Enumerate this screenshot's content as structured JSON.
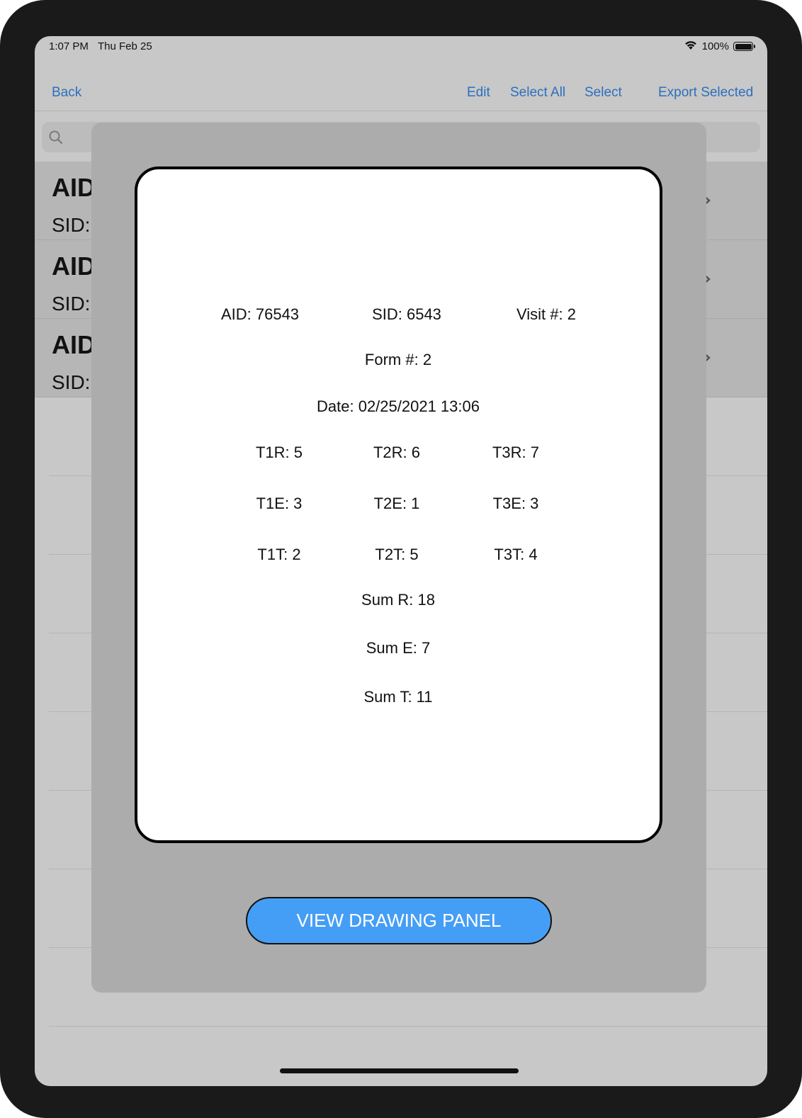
{
  "status_bar": {
    "time": "1:07 PM",
    "date": "Thu Feb 25",
    "battery": "100%"
  },
  "nav": {
    "back": "Back",
    "edit": "Edit",
    "select_all": "Select All",
    "select": "Select",
    "export_selected": "Export Selected"
  },
  "list": {
    "rows": [
      {
        "title": "AID",
        "subtitle": "SID:"
      },
      {
        "title": "AID",
        "subtitle": "SID:"
      },
      {
        "title": "AID",
        "subtitle": "SID:"
      }
    ]
  },
  "detail": {
    "aid": "AID: 76543",
    "sid": "SID: 6543",
    "visit": "Visit #: 2",
    "form": "Form #: 2",
    "date": "Date: 02/25/2021 13:06",
    "t1r": "T1R: 5",
    "t2r": "T2R: 6",
    "t3r": "T3R: 7",
    "t1e": "T1E: 3",
    "t2e": "T2E: 1",
    "t3e": "T3E: 3",
    "t1t": "T1T: 2",
    "t2t": "T2T: 5",
    "t3t": "T3T: 4",
    "sum_r": "Sum R: 18",
    "sum_e": "Sum E: 7",
    "sum_t": "Sum T: 11"
  },
  "actions": {
    "view_drawing_panel": "VIEW DRAWING PANEL"
  },
  "icons": {
    "search": "search-icon",
    "wifi": "wifi-icon",
    "battery": "battery-icon",
    "chevron": "chevron-right-icon"
  },
  "colors": {
    "link": "#2c6fbd",
    "button": "#459ef5"
  }
}
